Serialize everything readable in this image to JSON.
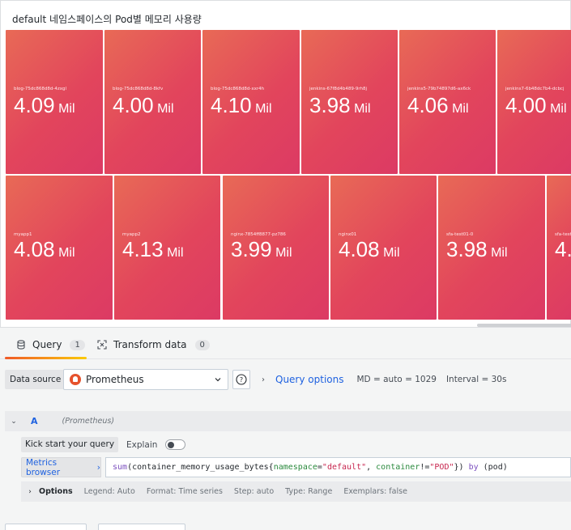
{
  "panel": {
    "title": "default 네임스페이스의 Pod별 메모리 사용량",
    "unit": "Mil",
    "row1": [
      {
        "name": "blog-75dc868d8d-4zxgl",
        "value": "4.09"
      },
      {
        "name": "blog-75dc868d8d-8kfv",
        "value": "4.00"
      },
      {
        "name": "blog-75dc868d8d-xxr4h",
        "value": "4.10"
      },
      {
        "name": "jenkins-67f8d4b489-9rh8j",
        "value": "3.98"
      },
      {
        "name": "jenkins5-79b74897d6-ax6ck",
        "value": "4.06"
      },
      {
        "name": "jenkins7-6b48dc7b4-dcbcj",
        "value": "4.00"
      }
    ],
    "row2": [
      {
        "name": "myapp1",
        "value": "4.08"
      },
      {
        "name": "myapp2",
        "value": "4.13"
      },
      {
        "name": "nginx-7854ff8877-pz786",
        "value": "3.99"
      },
      {
        "name": "nginx01",
        "value": "4.08"
      },
      {
        "name": "sfa-test01-0",
        "value": "3.98"
      },
      {
        "name": "sfa-test",
        "value": "4."
      }
    ]
  },
  "tabs": {
    "query_label": "Query",
    "query_count": "1",
    "transform_label": "Transform data",
    "transform_count": "0"
  },
  "datasource": {
    "label": "Data source",
    "selected": "Prometheus",
    "help": "?",
    "query_options_label": "Query options",
    "md": "MD = auto = 1029",
    "interval": "Interval = 30s"
  },
  "query": {
    "ref_id": "A",
    "ds_name": "(Prometheus)",
    "kick_start_label": "Kick start your query",
    "explain_label": "Explain",
    "metrics_browser_label": "Metrics browser",
    "metrics_browser_arrow": "›",
    "code": {
      "fn": "sum",
      "open": "(",
      "metric": "container_memory_usage_bytes",
      "brace_open": "{",
      "l1": "namespace",
      "eq": "=",
      "v1": "\"default\"",
      "comma": ", ",
      "l2": "container",
      "neq": "!=",
      "v2": "\"POD\"",
      "brace_close": "})",
      "by": " by ",
      "group": "(pod)"
    },
    "options": {
      "label": "Options",
      "legend": "Legend: Auto",
      "format": "Format: Time series",
      "step": "Step: auto",
      "type": "Type: Range",
      "exemplars": "Exemplars: false"
    }
  }
}
